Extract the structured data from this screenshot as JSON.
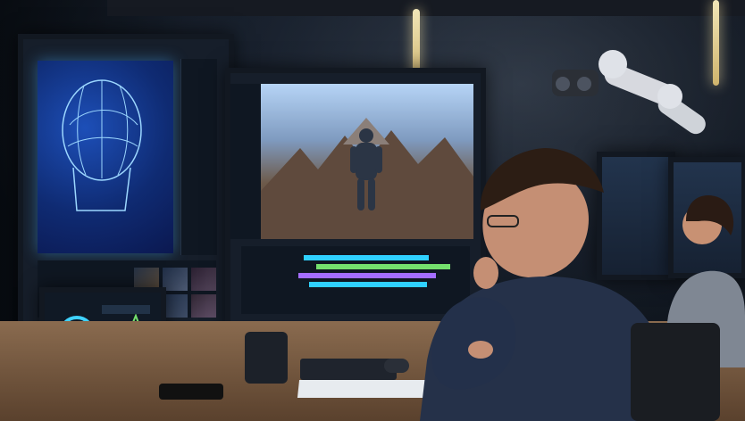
{
  "scene": {
    "description": "",
    "colors": {
      "background_dark": "#0b1119",
      "monitor_frame": "#121821",
      "ui_panel": "#161e2a",
      "blue_glow": "#4aa8ff",
      "timeline_cyan": "#2fd0ff",
      "timeline_green": "#74e06d",
      "timeline_purple": "#a46dff",
      "desk_wood": "#7a5a3d"
    }
  },
  "monitors": {
    "left": {
      "icon": "head-wireframe-icon",
      "thumbnails": [
        "thumbnail-1",
        "thumbnail-2",
        "thumbnail-3",
        "thumbnail-4",
        "thumbnail-5",
        "thumbnail-6"
      ]
    },
    "center": {
      "icon": "character-preview-icon",
      "timeline_tracks": [
        "track-1",
        "track-2",
        "track-3",
        "track-4"
      ]
    },
    "laptop": {
      "icon": "color-graph-icon"
    }
  },
  "people": {
    "main_artist": "person-main",
    "background_colleague": "person-background"
  }
}
